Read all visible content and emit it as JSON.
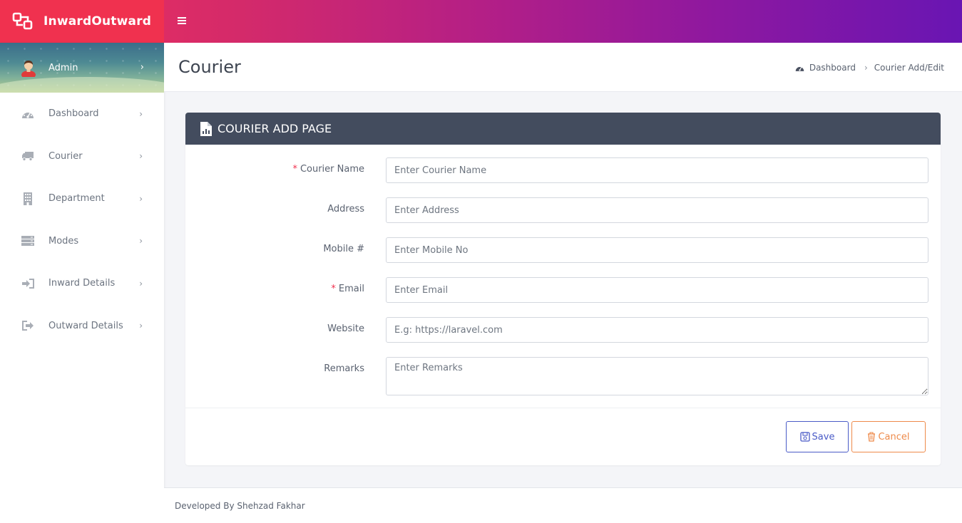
{
  "app": {
    "name": "InwardOutward",
    "accent": "#f0314f",
    "gradient_end": "#6915b3"
  },
  "topbar": {
    "menu_icon": "hamburger-icon"
  },
  "sidebar": {
    "user": {
      "name": "Admin",
      "icon": "avatar-icon"
    },
    "items": [
      {
        "label": "Dashboard",
        "icon": "dashboard-icon"
      },
      {
        "label": "Courier",
        "icon": "truck-icon"
      },
      {
        "label": "Department",
        "icon": "building-icon"
      },
      {
        "label": "Modes",
        "icon": "server-icon"
      },
      {
        "label": "Inward Details",
        "icon": "sign-in-icon"
      },
      {
        "label": "Outward Details",
        "icon": "sign-out-icon"
      }
    ]
  },
  "header": {
    "title": "Courier",
    "breadcrumb": [
      "Dashboard",
      "Courier Add/Edit"
    ]
  },
  "card": {
    "title": "COURIER ADD PAGE",
    "icon": "file-chart-icon",
    "fields": [
      {
        "label": "Courier Name",
        "required": "*",
        "placeholder": "Enter Courier Name",
        "value": ""
      },
      {
        "label": "Address",
        "required": "",
        "placeholder": "Enter Address",
        "value": ""
      },
      {
        "label": "Mobile #",
        "required": "",
        "placeholder": "Enter Mobile No",
        "value": ""
      },
      {
        "label": "Email",
        "required": "*",
        "placeholder": "Enter Email",
        "value": ""
      },
      {
        "label": "Website",
        "required": "",
        "placeholder": "E.g: https://laravel.com",
        "value": ""
      },
      {
        "label": "Remarks",
        "required": "",
        "placeholder": "Enter Remarks",
        "value": ""
      }
    ],
    "save_label": "Save",
    "cancel_label": "Cancel",
    "save_color": "#4a5bc7",
    "cancel_color": "#ee8a4a"
  },
  "footer": {
    "text": "Developed By Shehzad Fakhar"
  }
}
